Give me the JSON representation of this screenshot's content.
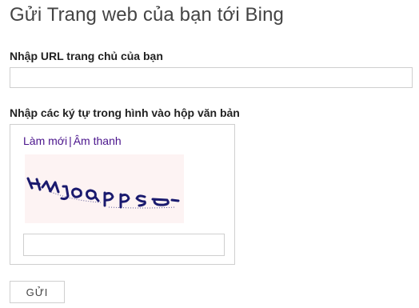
{
  "page": {
    "title": "Gửi Trang web của bạn tới Bing"
  },
  "url_section": {
    "label": "Nhập URL trang chủ của bạn",
    "value": "",
    "placeholder": ""
  },
  "captcha_section": {
    "label": "Nhập các ký tự trong hình vào hộp văn bản",
    "refresh_link": "Làm mới",
    "separator": "|",
    "audio_link": "Âm thanh",
    "image_text": "HMJOQPPS",
    "input_value": "",
    "input_placeholder": ""
  },
  "submit": {
    "label": "GỬI"
  },
  "colors": {
    "link": "#4a148c",
    "captcha_text": "#1a1a6e",
    "captcha_bg": "#fdf3f3",
    "border": "#cfcfcf"
  }
}
